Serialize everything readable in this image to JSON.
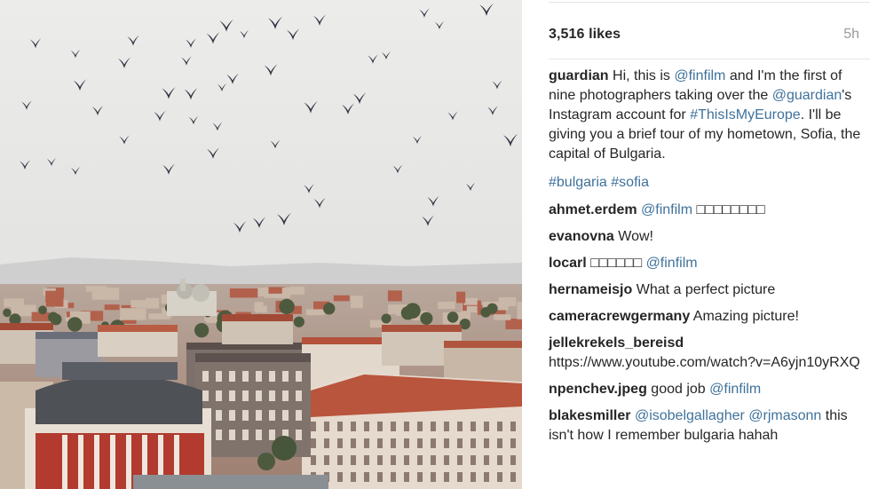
{
  "post": {
    "likes": "3,516 likes",
    "time": "5h",
    "caption": {
      "user": "guardian",
      "parts": [
        {
          "t": "text",
          "v": " Hi, this is "
        },
        {
          "t": "mention",
          "v": "@finfilm"
        },
        {
          "t": "text",
          "v": " and I'm the first of nine photographers taking over the "
        },
        {
          "t": "mention",
          "v": "@guardian"
        },
        {
          "t": "text",
          "v": "'s Instagram account for "
        },
        {
          "t": "tag",
          "v": "#ThisIsMyEurope"
        },
        {
          "t": "text",
          "v": ". I'll be giving you a brief tour of my hometown, Sofia, the capital of Bulgaria."
        }
      ]
    },
    "hashtags": [
      "#bulgaria",
      "#sofia"
    ]
  },
  "comments": [
    {
      "user": "ahmet.erdem",
      "parts": [
        {
          "t": "mention",
          "v": " @finfilm"
        },
        {
          "t": "text",
          "v": " □□□□□□□□"
        }
      ]
    },
    {
      "user": "evanovna",
      "parts": [
        {
          "t": "text",
          "v": " Wow!"
        }
      ]
    },
    {
      "user": "locarl",
      "parts": [
        {
          "t": "text",
          "v": " □□□□□□ "
        },
        {
          "t": "mention",
          "v": "@finfilm"
        }
      ]
    },
    {
      "user": "hernameisjo",
      "parts": [
        {
          "t": "text",
          "v": " What a perfect picture"
        }
      ]
    },
    {
      "user": "cameracrewgermany",
      "parts": [
        {
          "t": "text",
          "v": " Amazing picture!"
        }
      ]
    },
    {
      "user": "jellekrekels_bereisd",
      "parts": [
        {
          "t": "text",
          "v": " https://www.youtube.com/watch?v=A6yjn10yRXQ"
        }
      ]
    },
    {
      "user": "npenchev.jpeg",
      "parts": [
        {
          "t": "text",
          "v": " good job "
        },
        {
          "t": "mention",
          "v": "@finfilm"
        }
      ]
    },
    {
      "user": "blakesmiller",
      "parts": [
        {
          "t": "text",
          "v": " "
        },
        {
          "t": "mention",
          "v": "@isobelgallagher"
        },
        {
          "t": "text",
          "v": " "
        },
        {
          "t": "mention",
          "v": "@rjmasonn"
        },
        {
          "t": "text",
          "v": " this isn't how I remember bulgaria hahah"
        }
      ]
    }
  ],
  "colors": {
    "text": "#262626",
    "link": "#3f729b",
    "muted": "#9a9a9a",
    "sky": "#e4e4e2",
    "birds": "#2f3140",
    "roofs": "#b5563f",
    "dome": "#4a4d52"
  }
}
